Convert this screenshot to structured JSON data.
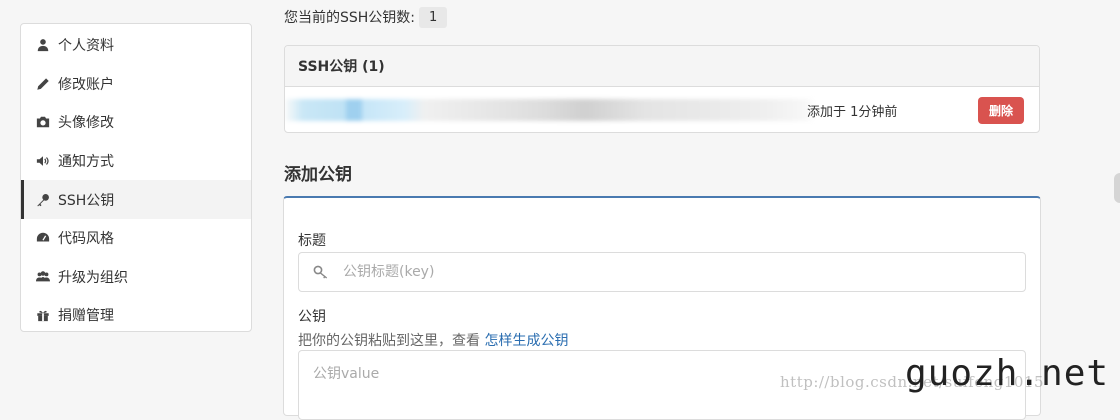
{
  "sidebar": {
    "items": [
      {
        "label": "个人资料",
        "icon": "user-icon"
      },
      {
        "label": "修改账户",
        "icon": "pencil-icon"
      },
      {
        "label": "头像修改",
        "icon": "camera-icon"
      },
      {
        "label": "通知方式",
        "icon": "volume-icon"
      },
      {
        "label": "SSH公钥",
        "icon": "key-icon",
        "active": true
      },
      {
        "label": "代码风格",
        "icon": "dashboard-icon"
      },
      {
        "label": "升级为组织",
        "icon": "group-icon"
      },
      {
        "label": "捐赠管理",
        "icon": "gift-icon"
      }
    ]
  },
  "ssh": {
    "count_label": "您当前的SSH公钥数:",
    "count": "1",
    "panel_title": "SSH公钥 (1)",
    "keys": [
      {
        "added": "添加于 1分钟前",
        "delete_label": "删除"
      }
    ]
  },
  "add_key": {
    "heading": "添加公钥",
    "title_label": "标题",
    "title_placeholder": "公钥标题(key)",
    "key_label": "公钥",
    "help_prefix": "把你的公钥粘贴到这里，查看 ",
    "help_link": "怎样生成公钥",
    "key_placeholder": "公钥value"
  },
  "watermarks": {
    "blog": "http://blog.csdn.net/suifeng1015",
    "site": "guozh.net"
  },
  "colors": {
    "danger": "#d9534f",
    "link": "#2a6db0",
    "form_accent": "#4a7ab0"
  }
}
